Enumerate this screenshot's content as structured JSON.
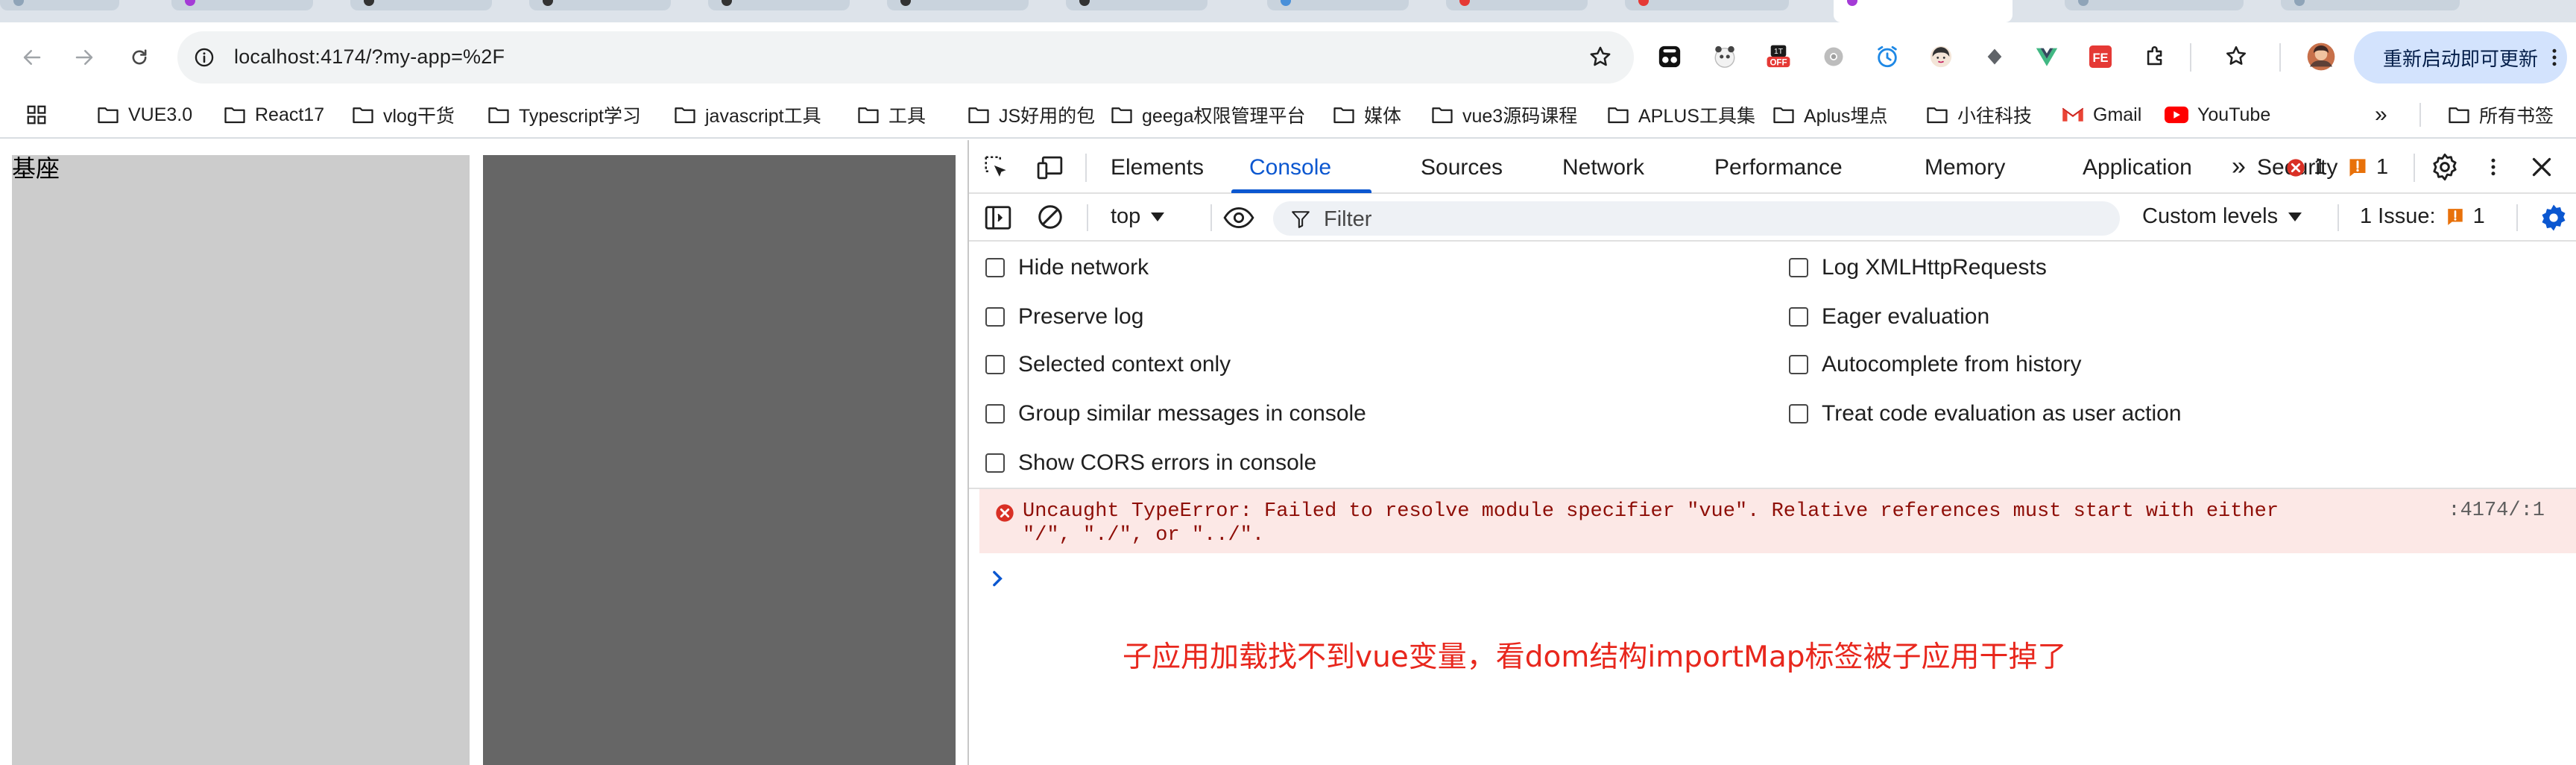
{
  "browser": {
    "url": "localhost:4174/?my-app=%2F",
    "restart_label": "重新启动即可更新",
    "extensions": [
      "tampermonkey-icon",
      "panda-icon",
      "off-badge-icon",
      "chrome-gray-icon",
      "alarm-icon",
      "avatar-girl-icon",
      "diamond-icon",
      "vue-icon",
      "fe-icon",
      "puzzle-icon",
      "star-list-icon"
    ]
  },
  "bookmarks": {
    "items": [
      "VUE3.0",
      "React17",
      "vlog干货",
      "Typescript学习",
      "javascript工具",
      "工具",
      "JS好用的包",
      "geega权限管理平台",
      "媒体",
      "vue3源码课程",
      "APLUS工具集",
      "Aplus埋点",
      "小往科技",
      "Gmail",
      "YouTube"
    ],
    "more": "»",
    "all_bookmarks": "所有书签"
  },
  "page": {
    "title": "基座"
  },
  "devtools": {
    "tabs": [
      "Elements",
      "Console",
      "Sources",
      "Network",
      "Performance",
      "Memory",
      "Application",
      "Security"
    ],
    "more_tabs": "»",
    "error_count": "1",
    "warning_count": "1",
    "context": "top",
    "filter_placeholder": "Filter",
    "levels": "Custom levels",
    "issues_label": "1 Issue:",
    "issues_count": "1",
    "settings_left": [
      "Hide network",
      "Preserve log",
      "Selected context only",
      "Group similar messages in console",
      "Show CORS errors in console"
    ],
    "settings_right": [
      "Log XMLHttpRequests",
      "Eager evaluation",
      "Autocomplete from history",
      "Treat code evaluation as user action"
    ],
    "error_message": "Uncaught TypeError: Failed to resolve module specifier \"vue\". Relative references must start with either \"/\", \"./\", or \"../\".",
    "error_source": ":4174/:1",
    "annotation": "子应用加载找不到vue变量，看dom结构importMap标签被子应用干掉了"
  },
  "colors": {
    "accent": "#0b57d0",
    "error": "#d93025",
    "error_bg": "#fce8e6",
    "annotation": "#e8271d",
    "warning": "#e8710a"
  }
}
